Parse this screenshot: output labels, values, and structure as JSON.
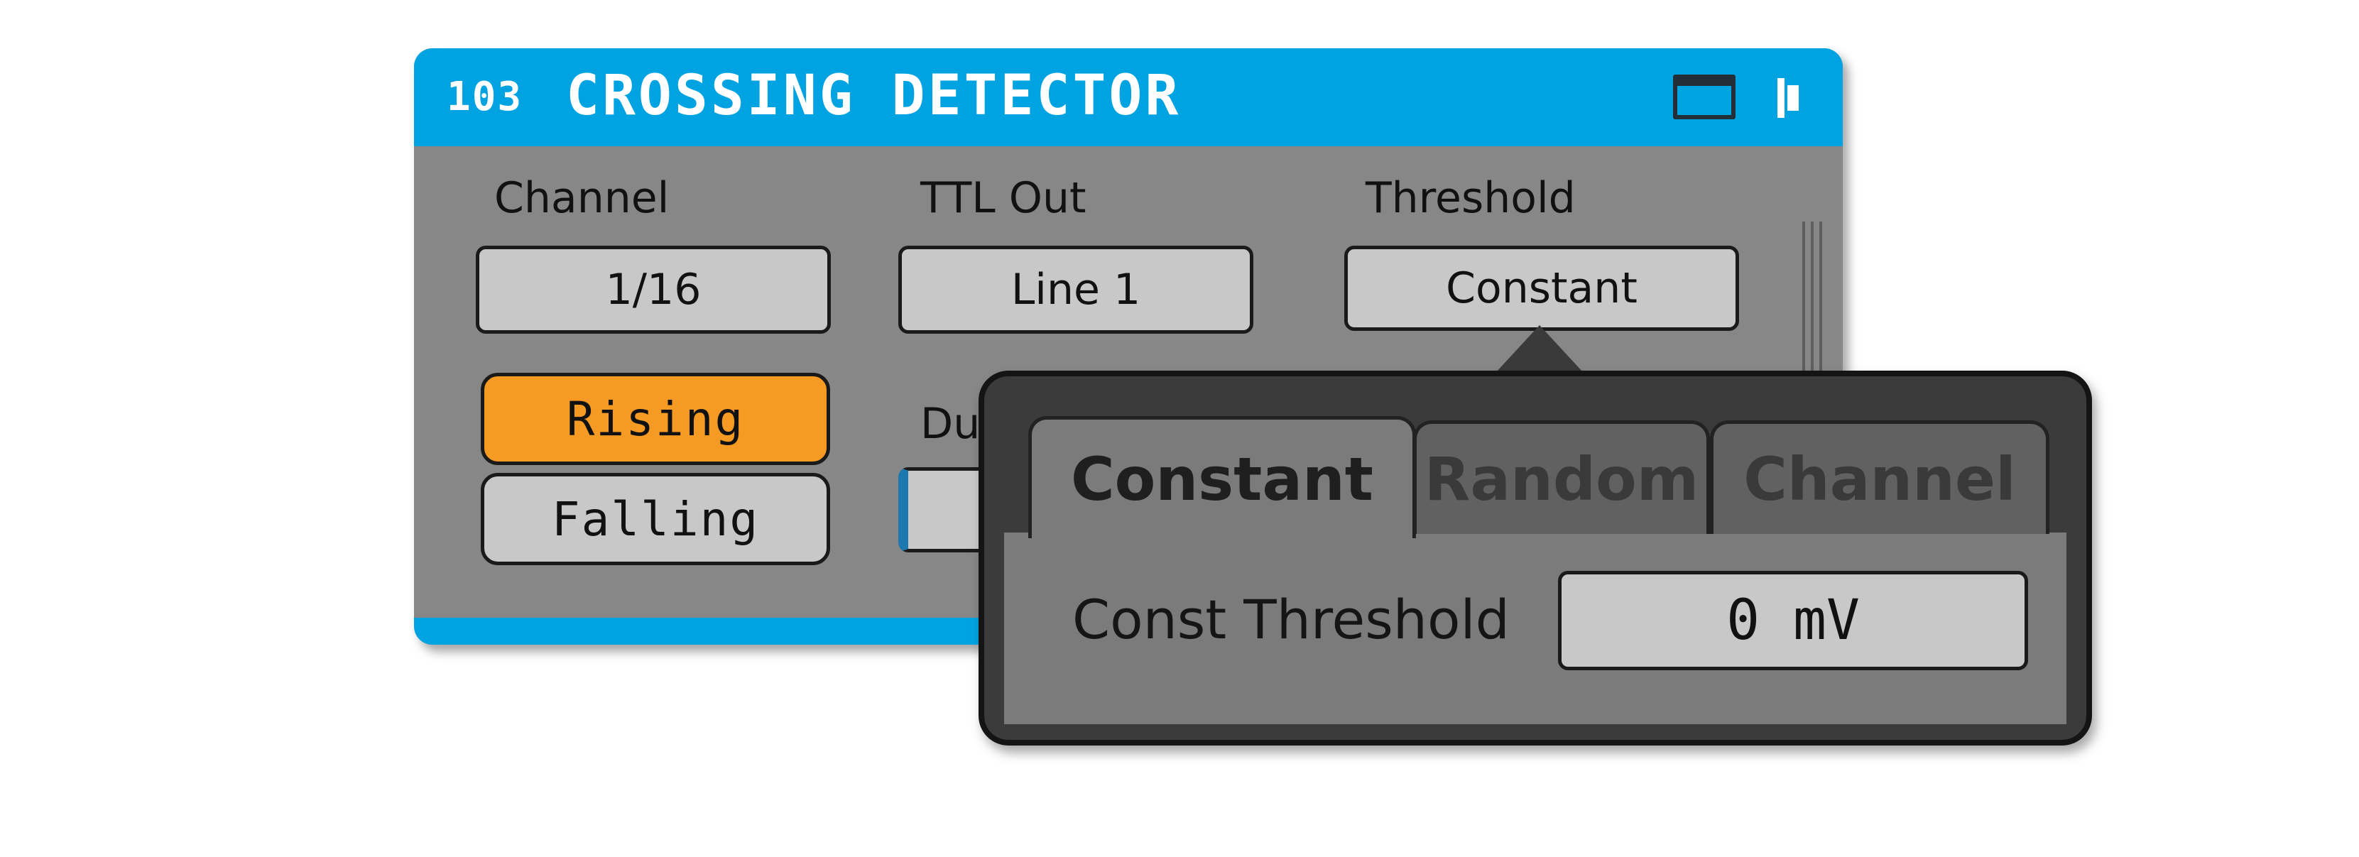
{
  "panel": {
    "node_id": "103",
    "title": "CROSSING DETECTOR",
    "channel": {
      "label": "Channel",
      "value": "1/16"
    },
    "ttl_out": {
      "label": "TTL Out",
      "value": "Line 1"
    },
    "threshold": {
      "label": "Threshold",
      "value": "Constant"
    },
    "direction": {
      "rising": "Rising",
      "falling": "Falling",
      "selected": "Rising"
    },
    "duration": {
      "label": "Du"
    }
  },
  "popup": {
    "tabs": [
      {
        "label": "Constant",
        "active": true
      },
      {
        "label": "Random",
        "active": false
      },
      {
        "label": "Channel",
        "active": false
      }
    ],
    "const_threshold": {
      "label": "Const Threshold",
      "value": "0 mV"
    }
  },
  "icons": {
    "window": "window-icon",
    "pin": "pin-icon"
  },
  "colors": {
    "header": "#00a3e1",
    "panel_bg": "#878787",
    "active_toggle": "#f59a23",
    "field_bg": "#c8c8c8",
    "popup_border": "#141414"
  }
}
